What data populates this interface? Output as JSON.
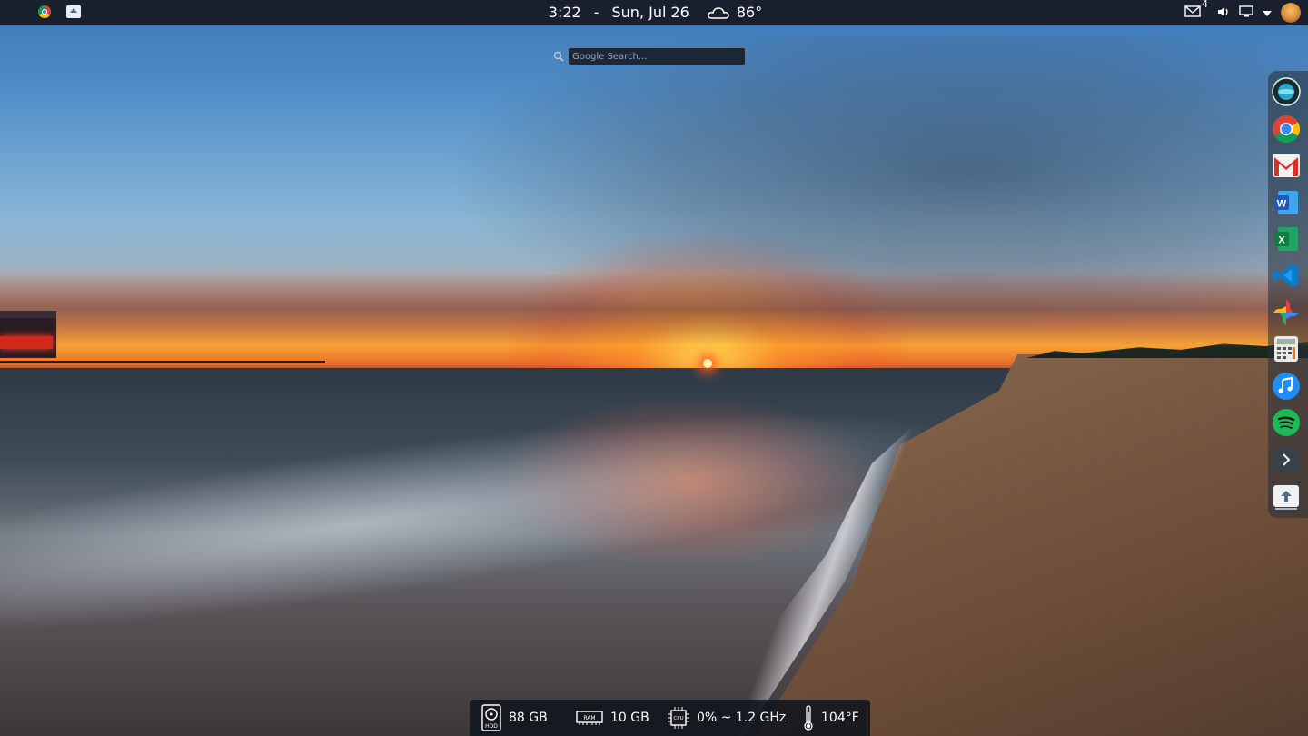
{
  "top_panel": {
    "time": "3:22",
    "separator": "-",
    "date": "Sun, Jul 26",
    "weather_icon": "cloud-icon",
    "temperature": "86°",
    "mail_count": "4",
    "left_apps": [
      "chrome-icon",
      "share-icon"
    ],
    "right_icons": [
      "mail-icon",
      "volume-icon",
      "display-icon",
      "dropdown-arrow-icon",
      "user-avatar"
    ]
  },
  "search": {
    "placeholder": "Google Search..."
  },
  "dock": {
    "items": [
      "dock-launcher-icon",
      "chrome-icon",
      "gmail-icon",
      "word-icon",
      "excel-icon",
      "vscode-icon",
      "photos-icon",
      "calculator-icon",
      "music-icon",
      "spotify-icon",
      "expand-arrow-icon",
      "share-icon"
    ]
  },
  "stats": {
    "hdd": {
      "label": "HDD",
      "value": "88 GB"
    },
    "ram": {
      "label": "RAM",
      "value": "10 GB"
    },
    "cpu": {
      "label": "CPU",
      "value": "0% ~ 1.2 GHz"
    },
    "temp": {
      "value": "104°F"
    }
  },
  "colors": {
    "panel_bg": "#1a1f2e",
    "stats_bg": "#10141c"
  }
}
